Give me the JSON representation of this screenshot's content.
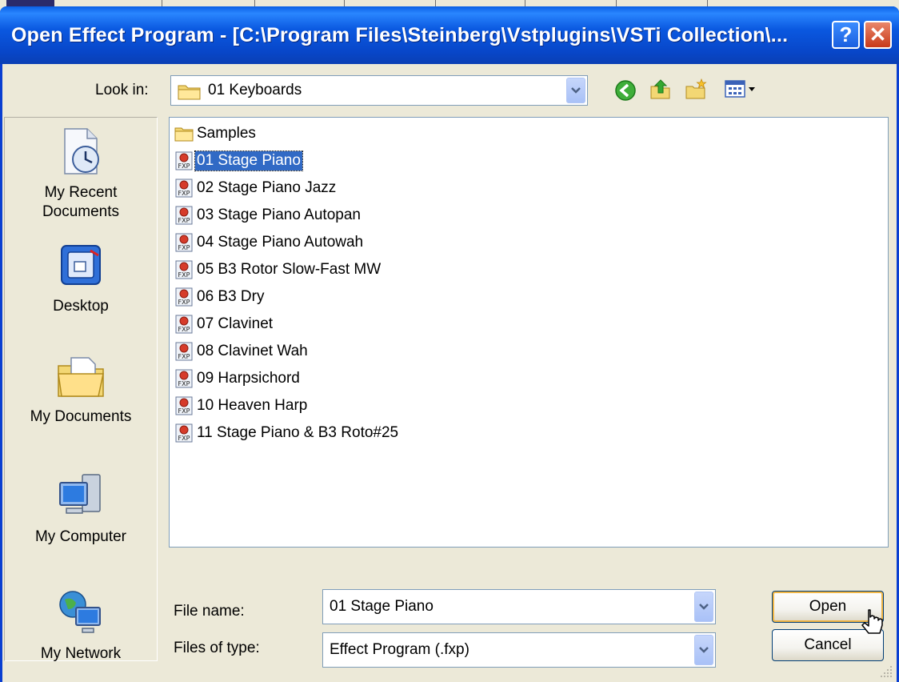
{
  "window": {
    "title": "Open Effect Program - [C:\\Program Files\\Steinberg\\Vstplugins\\VSTi Collection\\...",
    "help_glyph": "?",
    "close_glyph": "✕"
  },
  "look_in": {
    "label": "Look in:",
    "value": "01 Keyboards"
  },
  "toolbar": {
    "icons": [
      "back-icon",
      "up-folder-icon",
      "new-folder-icon",
      "view-menu-icon"
    ]
  },
  "places": [
    {
      "label": "My Recent Documents",
      "icon": "recent-documents-icon"
    },
    {
      "label": "Desktop",
      "icon": "desktop-icon"
    },
    {
      "label": "My Documents",
      "icon": "my-documents-icon"
    },
    {
      "label": "My Computer",
      "icon": "my-computer-icon"
    },
    {
      "label": "My Network",
      "icon": "my-network-icon"
    }
  ],
  "files": [
    {
      "name": "Samples",
      "type": "folder",
      "selected": false
    },
    {
      "name": "01 Stage Piano",
      "type": "fxp",
      "selected": true
    },
    {
      "name": "02 Stage Piano Jazz",
      "type": "fxp",
      "selected": false
    },
    {
      "name": "03 Stage Piano Autopan",
      "type": "fxp",
      "selected": false
    },
    {
      "name": "04 Stage Piano Autowah",
      "type": "fxp",
      "selected": false
    },
    {
      "name": "05 B3 Rotor Slow-Fast MW",
      "type": "fxp",
      "selected": false
    },
    {
      "name": "06 B3 Dry",
      "type": "fxp",
      "selected": false
    },
    {
      "name": "07 Clavinet",
      "type": "fxp",
      "selected": false
    },
    {
      "name": "08 Clavinet Wah",
      "type": "fxp",
      "selected": false
    },
    {
      "name": "09 Harpsichord",
      "type": "fxp",
      "selected": false
    },
    {
      "name": "10 Heaven Harp",
      "type": "fxp",
      "selected": false
    },
    {
      "name": "11 Stage Piano & B3 Roto#25",
      "type": "fxp",
      "selected": false
    }
  ],
  "file_name": {
    "label": "File name:",
    "value": "01 Stage Piano"
  },
  "file_type": {
    "label": "Files of type:",
    "value": "Effect Program (.fxp)"
  },
  "buttons": {
    "open": "Open",
    "cancel": "Cancel"
  },
  "colors": {
    "titlebar": "#0a58e0",
    "selection": "#316ac5",
    "dialog_bg": "#ece9d8"
  }
}
